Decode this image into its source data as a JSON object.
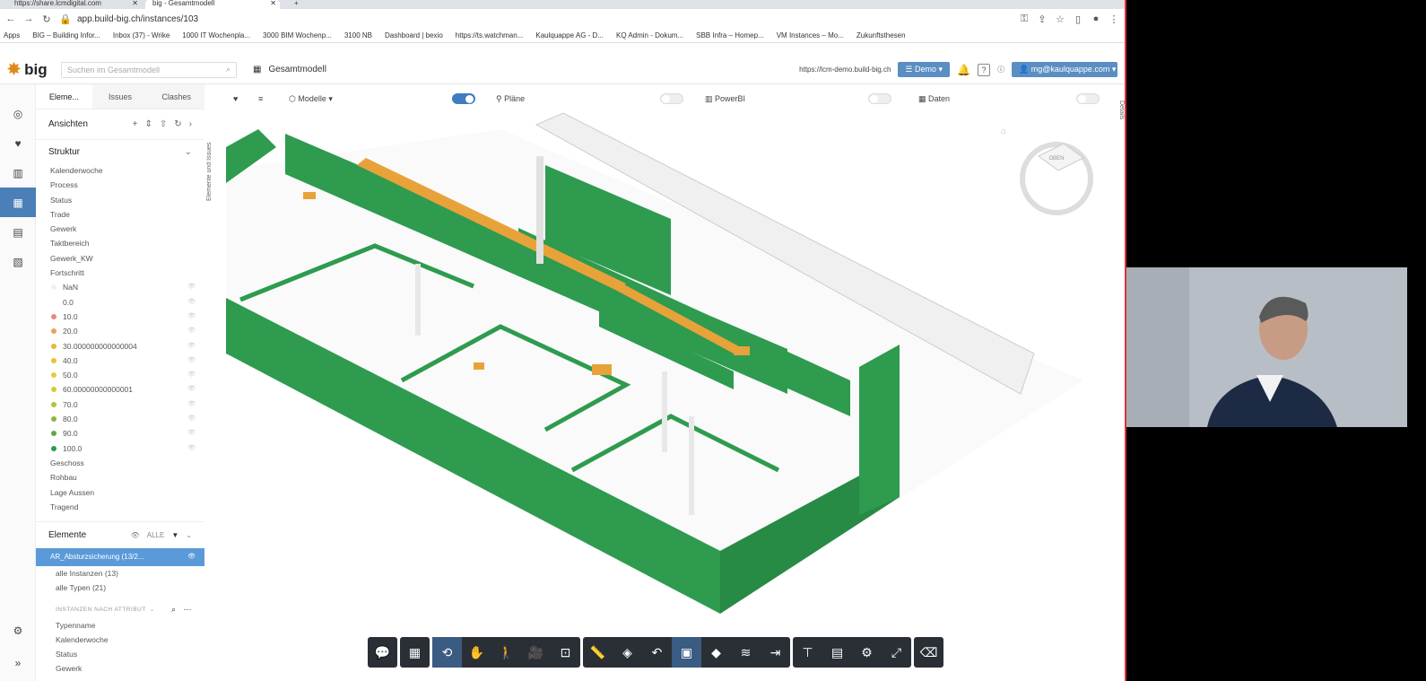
{
  "browser": {
    "tabs": [
      {
        "title": "https://share.lcmdigital.com"
      },
      {
        "title": "big - Gesamtmodell"
      }
    ],
    "url": "app.build-big.ch/instances/103",
    "bookmarks": [
      "Apps",
      "BIG – Building Infor...",
      "Inbox (37) - Wrike",
      "1000 IT Wochenpla...",
      "3000 BIM Wochenp...",
      "3100 NB",
      "Dashboard | bexio",
      "https://ts.watchman...",
      "Kaulquappe AG - D...",
      "KQ Admin - Dokum...",
      "SBB Infra – Homep...",
      "VM Instances – Mo...",
      "Zukunftsthesen"
    ]
  },
  "header": {
    "logo": "big",
    "search_placeholder": "Suchen im Gesamtmodell",
    "model_title": "Gesamtmodell",
    "instance_url": "https://lcm-demo.build-big.ch",
    "demo_label": "Demo",
    "user_label": "mg@kaulquappe.com"
  },
  "sidebar": {
    "tabs": [
      "Eleme...",
      "Issues",
      "Clashes"
    ],
    "views_label": "Ansichten",
    "structure_label": "Struktur",
    "structure_items": [
      "Kalenderwoche",
      "Process",
      "Status",
      "Trade",
      "Gewerk",
      "Taktbereich",
      "Gewerk_KW",
      "Fortschritt"
    ],
    "progress_values": [
      {
        "label": "NaN",
        "color": "#f0f0f0"
      },
      {
        "label": "0.0",
        "color": ""
      },
      {
        "label": "10.0",
        "color": "#e58a7c"
      },
      {
        "label": "20.0",
        "color": "#e9a35a"
      },
      {
        "label": "30.000000000000004",
        "color": "#e8b640"
      },
      {
        "label": "40.0",
        "color": "#e8c33a"
      },
      {
        "label": "50.0",
        "color": "#e5cc3a"
      },
      {
        "label": "60.00000000000001",
        "color": "#d8cc36"
      },
      {
        "label": "70.0",
        "color": "#b8c23a"
      },
      {
        "label": "80.0",
        "color": "#8db53e"
      },
      {
        "label": "90.0",
        "color": "#5fa848"
      },
      {
        "label": "100.0",
        "color": "#2e9a4e"
      }
    ],
    "structure_items_after": [
      "Geschoss",
      "Rohbau",
      "Lage Aussen",
      "Tragend"
    ],
    "elements_label": "Elemente",
    "elements_all": "ALLE",
    "selected_element": "AR_Absturzsicherung (13/2...",
    "sub_items": [
      "alle Instanzen (13)",
      "alle Typen (21)"
    ],
    "attr_header": "INSTANZEN NACH ATTRIBUT",
    "attr_items": [
      "Typenname",
      "Kalenderwoche",
      "Status",
      "Gewerk"
    ]
  },
  "viewer": {
    "modelle_label": "Modelle",
    "plaene_label": "Pläne",
    "powerbi_label": "PowerBI",
    "daten_label": "Daten",
    "left_strip": "Elemente und Issues",
    "right_strip": "Details",
    "cube_label": "OBEN"
  },
  "colors": {
    "accent": "#4a7fb8",
    "model_green": "#2e9b4f",
    "ducts_orange": "#e8a23a",
    "toolbar_dark": "#2a2f36"
  }
}
